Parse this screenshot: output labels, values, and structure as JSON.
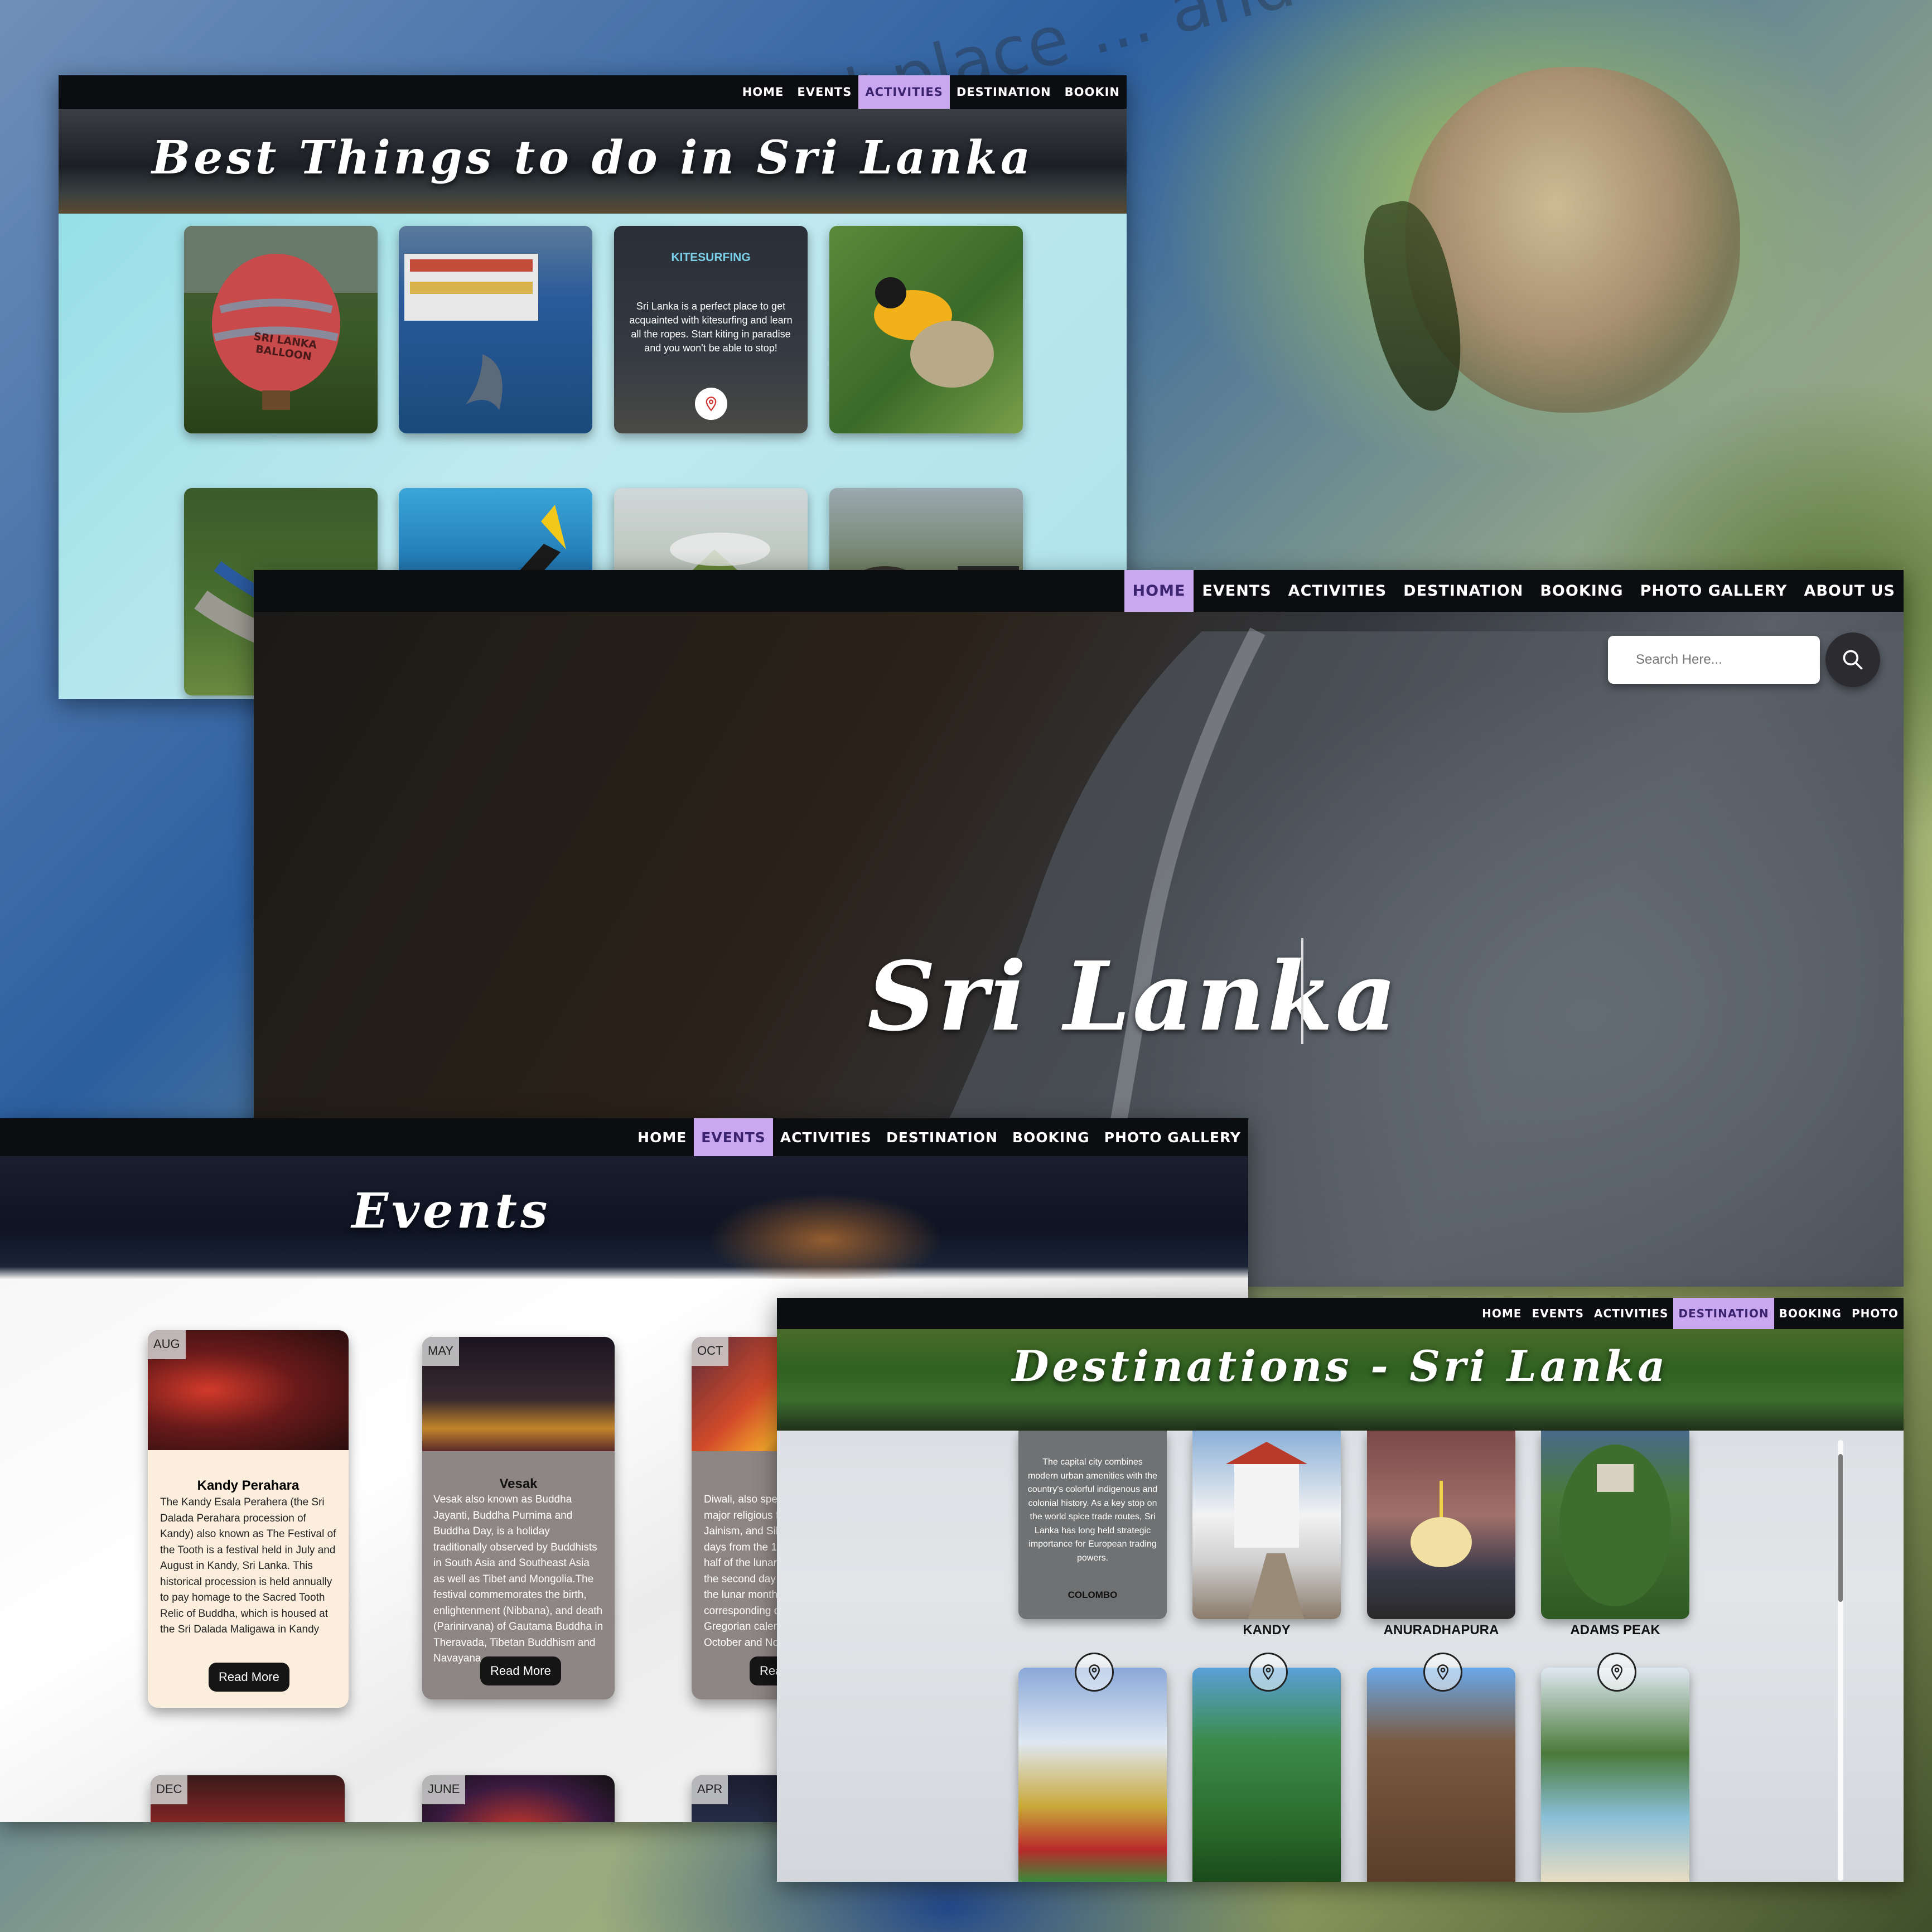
{
  "background": {
    "watermark_text": "is a perfect place ... and learn all"
  },
  "activities_page": {
    "nav": [
      "HOME",
      "EVENTS",
      "ACTIVITIES",
      "DESTINATION",
      "BOOKIN"
    ],
    "active_nav": "ACTIVITIES",
    "title": "Best Things to do in Sri Lanka",
    "cards": [
      {
        "name": "hot-air-balloon",
        "image_text": "SRI LANKA BALLOON"
      },
      {
        "name": "whale-watching"
      },
      {
        "name": "kitesurfing",
        "heading": "KITESURFING",
        "text": "Sri Lanka is a perfect place to get acquainted with kitesurfing and learn all the ropes. Start kiting in paradise and you won't be able to stop!",
        "icon": "map-pin-icon"
      },
      {
        "name": "bird-watching"
      },
      {
        "name": "train-ride"
      },
      {
        "name": "snorkeling"
      },
      {
        "name": "hiking"
      },
      {
        "name": "safari"
      }
    ]
  },
  "home_page": {
    "nav": [
      "HOME",
      "EVENTS",
      "ACTIVITIES",
      "DESTINATION",
      "BOOKING",
      "PHOTO GALLERY",
      "ABOUT US"
    ],
    "active_nav": "HOME",
    "search": {
      "placeholder": "Search Here..."
    },
    "hero_title": "Sri Lanka"
  },
  "events_page": {
    "nav": [
      "HOME",
      "EVENTS",
      "ACTIVITIES",
      "DESTINATION",
      "BOOKING",
      "PHOTO GALLERY"
    ],
    "active_nav": "EVENTS",
    "title": "Events",
    "cards": [
      {
        "month": "AUG",
        "title": "Kandy Perahara",
        "text": "The Kandy Esala Perahera (the Sri Dalada Perahara procession of Kandy) also known as The Festival of the Tooth is a festival held in July and August in Kandy, Sri Lanka. This historical procession is held annually to pay homage to the Sacred Tooth Relic of Buddha, which is housed at the Sri Dalada Maligawa in Kandy",
        "button": "Read More"
      },
      {
        "month": "MAY",
        "title": "Vesak",
        "text": "Vesak also known as Buddha Jayanti, Buddha Purnima and Buddha Day, is a holiday traditionally observed by Buddhists in South Asia and Southeast Asia as well as Tibet and Mongolia.The festival commemorates the birth, enlightenment (Nibbana), and death (Parinirvana) of Gautama Buddha in Theravada, Tibetan Buddhism and Navayana.",
        "button": "Read More"
      },
      {
        "month": "OCT",
        "text_fragments": [
          "Diwali, also spel",
          "major religious f",
          "Jainism, and Sikh",
          "days from the 1",
          "half of the lunar",
          "the second day",
          "the lunar month",
          "corresponding d",
          "Gregorian calen",
          "October and No"
        ],
        "button": "Rea"
      },
      {
        "month": "DEC"
      },
      {
        "month": "JUNE"
      },
      {
        "month": "APR"
      }
    ]
  },
  "destination_page": {
    "nav": [
      "HOME",
      "EVENTS",
      "ACTIVITIES",
      "DESTINATION",
      "BOOKING",
      "PHOTO"
    ],
    "active_nav": "DESTINATION",
    "title": "Destinations - Sri Lanka",
    "colombo": {
      "text": "The capital city combines modern urban amenities with the country's colorful indigenous and colonial history. As a key stop on the world spice trade routes, Sri Lanka has long held strategic importance for European trading powers.",
      "label": "COLOMBO"
    },
    "labels": [
      "KANDY",
      "ANURADHAPURA",
      "ADAMS PEAK"
    ]
  },
  "colors": {
    "nav_bg": "#0c0d10",
    "active_nav_bg": "#c9a8f0",
    "active_nav_text": "#3b2370",
    "read_more_bg": "#151515"
  }
}
